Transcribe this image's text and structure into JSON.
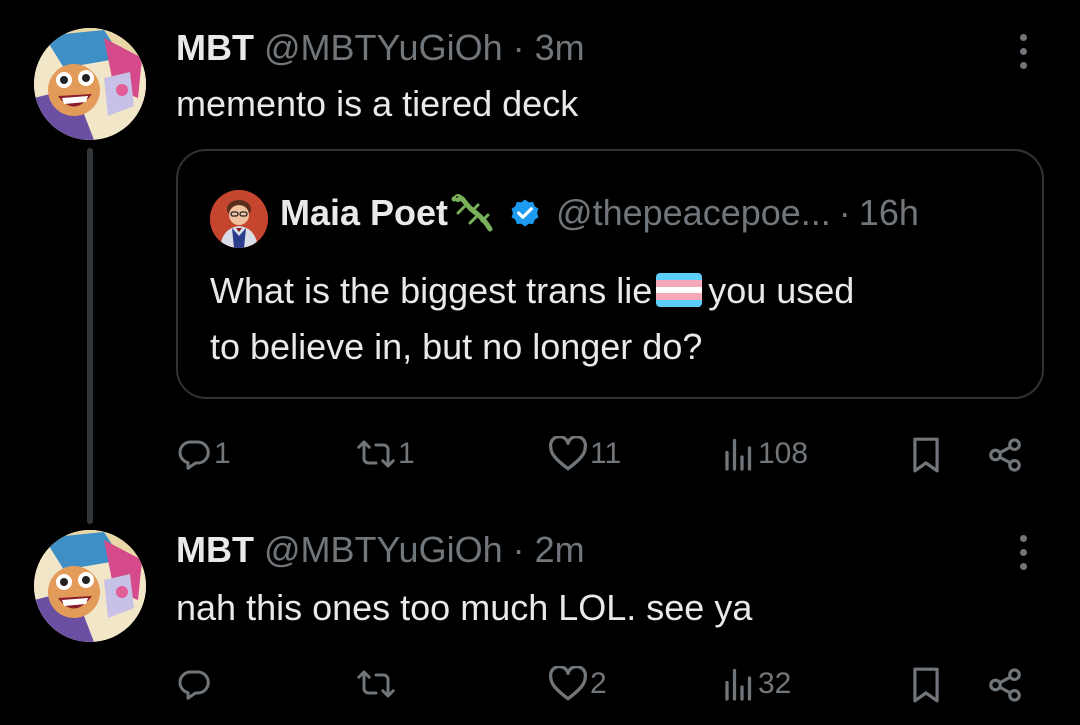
{
  "thread": [
    {
      "author": {
        "name": "MBT",
        "handle": "@MBTYuGiOh",
        "avatar": "cartoon-avatar"
      },
      "separator": "·",
      "time": "3m",
      "text": "memento is a tiered deck",
      "quote": {
        "author": {
          "name": "Maia Poet",
          "handle": "@thepeacepoe...",
          "emoji": "lizard-icon",
          "verified": true
        },
        "separator": "·",
        "time": "16h",
        "text_before_flag": "What is the biggest trans lie",
        "flag_icon": "transgender-flag-icon",
        "text_after_flag": "you used",
        "text_line2": "to believe in, but no longer do?"
      },
      "actions": {
        "replies": "1",
        "reposts": "1",
        "likes": "11",
        "views": "108"
      }
    },
    {
      "author": {
        "name": "MBT",
        "handle": "@MBTYuGiOh",
        "avatar": "cartoon-avatar"
      },
      "separator": "·",
      "time": "2m",
      "text": "nah this ones too much LOL. see ya",
      "actions": {
        "replies": "",
        "reposts": "",
        "likes": "2",
        "views": "32"
      }
    }
  ],
  "colors": {
    "background": "#000000",
    "text": "#e7e9ea",
    "muted": "#71767b",
    "border": "#2f3336",
    "verified": "#1d9bf0"
  }
}
